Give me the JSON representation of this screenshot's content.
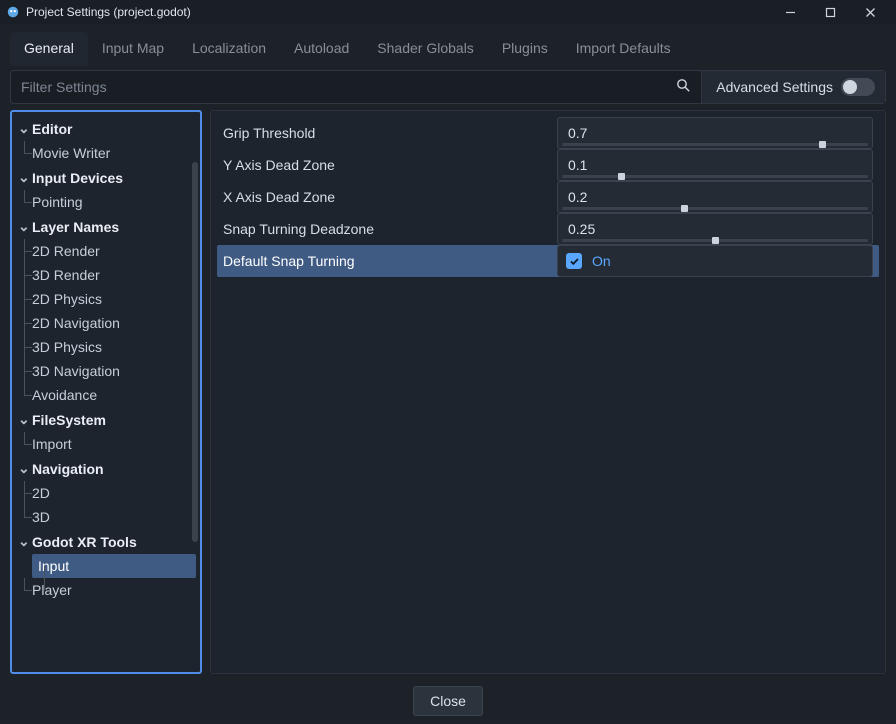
{
  "window": {
    "title": "Project Settings (project.godot)"
  },
  "tabs": [
    "General",
    "Input Map",
    "Localization",
    "Autoload",
    "Shader Globals",
    "Plugins",
    "Import Defaults"
  ],
  "active_tab": 0,
  "filter": {
    "placeholder": "Filter Settings"
  },
  "advanced": {
    "label": "Advanced Settings",
    "on": false
  },
  "sidebar": {
    "categories": [
      {
        "name": "Editor",
        "items": [
          "Movie Writer"
        ]
      },
      {
        "name": "Input Devices",
        "items": [
          "Pointing"
        ]
      },
      {
        "name": "Layer Names",
        "items": [
          "2D Render",
          "3D Render",
          "2D Physics",
          "2D Navigation",
          "3D Physics",
          "3D Navigation",
          "Avoidance"
        ]
      },
      {
        "name": "FileSystem",
        "items": [
          "Import"
        ]
      },
      {
        "name": "Navigation",
        "items": [
          "2D",
          "3D"
        ]
      },
      {
        "name": "Godot XR Tools",
        "items": [
          "Input",
          "Player"
        ]
      }
    ],
    "selected": "Input"
  },
  "properties": [
    {
      "label": "Grip Threshold",
      "value": "0.7",
      "pos": 0.84,
      "type": "slider"
    },
    {
      "label": "Y Axis Dead Zone",
      "value": "0.1",
      "pos": 0.2,
      "type": "slider"
    },
    {
      "label": "X Axis Dead Zone",
      "value": "0.2",
      "pos": 0.4,
      "type": "slider"
    },
    {
      "label": "Snap Turning Deadzone",
      "value": "0.25",
      "pos": 0.5,
      "type": "slider"
    },
    {
      "label": "Default Snap Turning",
      "value": "On",
      "checked": true,
      "type": "check",
      "highlighted": true
    }
  ],
  "footer": {
    "close": "Close"
  }
}
